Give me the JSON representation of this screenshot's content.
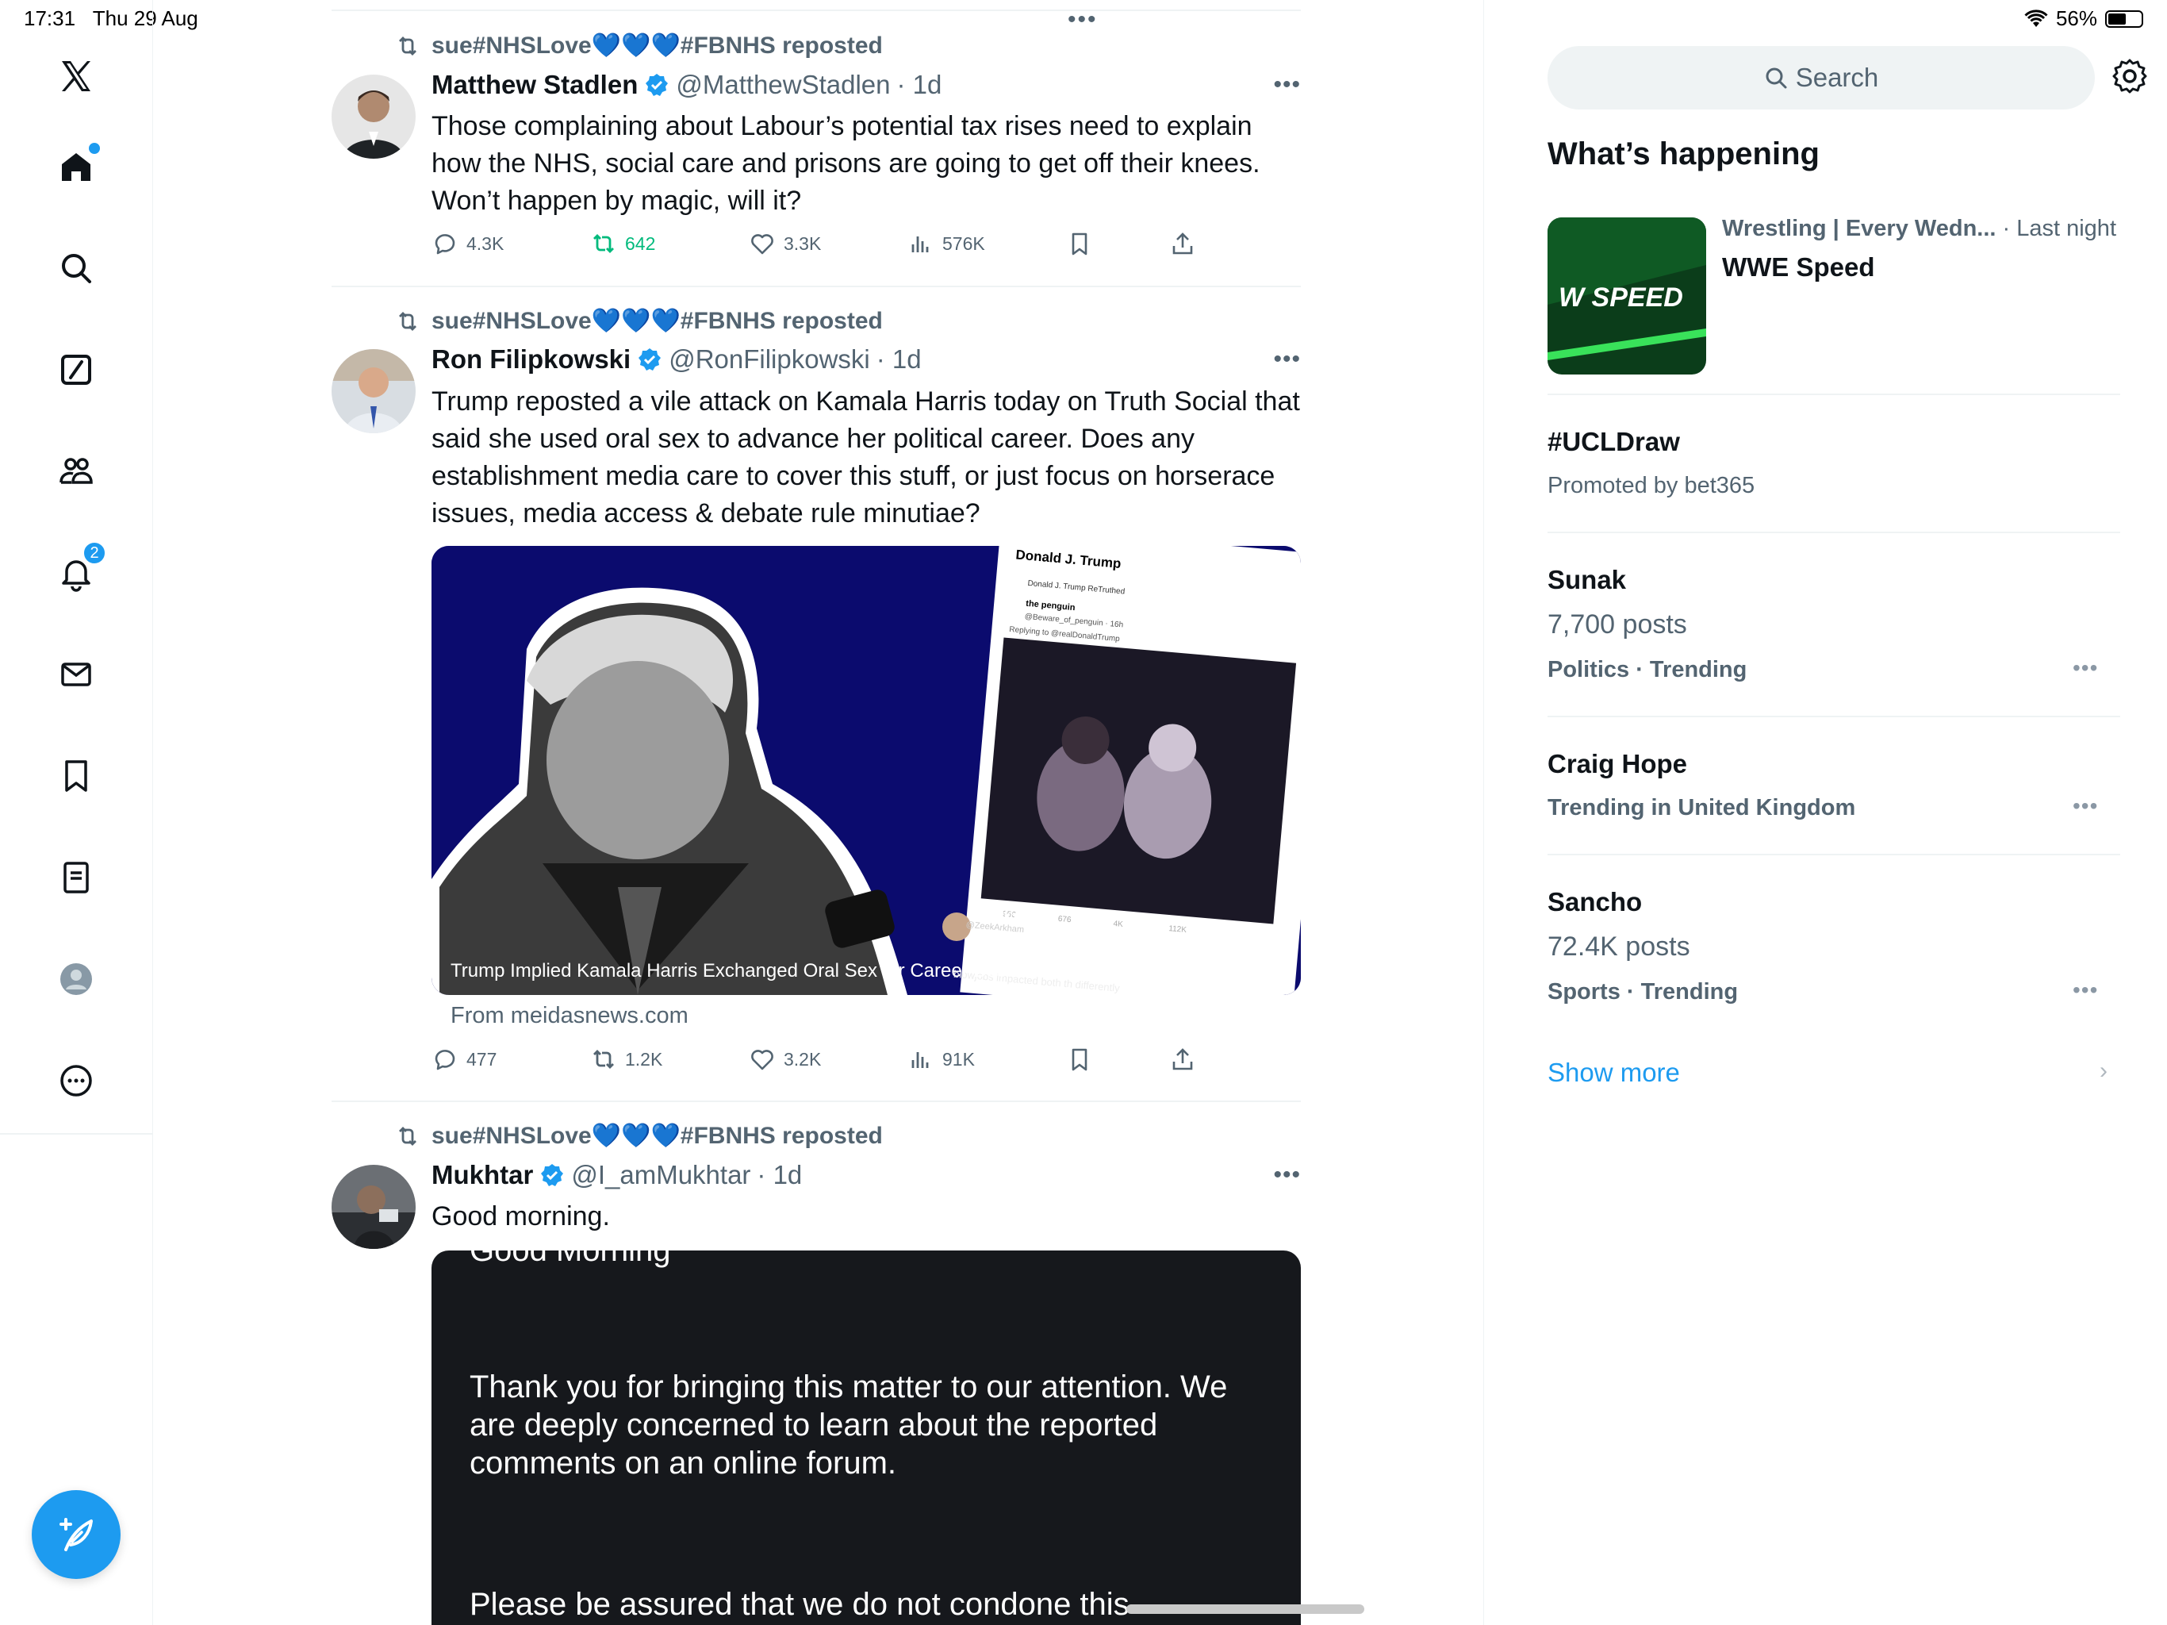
{
  "status_bar": {
    "time": "17:31",
    "date": "Thu 29 Aug",
    "battery": "56%",
    "battery_level": 0.56
  },
  "nav": {
    "icons": [
      "x-logo-icon",
      "home-icon",
      "search-icon",
      "grok-icon",
      "communities-icon",
      "notifications-icon",
      "messages-icon",
      "bookmarks-icon",
      "lists-icon",
      "profile-icon",
      "more-icon"
    ],
    "notification_count": "2"
  },
  "colors": {
    "accent": "#1d9bf0",
    "repost_green": "#00ba7c",
    "text_primary": "#0f1419",
    "text_secondary": "#536471"
  },
  "timeline": {
    "tweets": [
      {
        "reposted_by": "sue#NHSLove💙💙💙#FBNHS reposted",
        "name": "Matthew Stadlen",
        "handle": "@MatthewStadlen",
        "time": "· 1d",
        "text": "Those complaining about Labour’s potential tax rises need to explain how the NHS, social care and prisons are going to get off their knees. Won’t happen by magic, will it?",
        "replies": "4.3K",
        "reposts": "642",
        "likes": "3.3K",
        "views": "576K"
      },
      {
        "reposted_by": "sue#NHSLove💙💙💙#FBNHS reposted",
        "name": "Ron Filipkowski",
        "handle": "@RonFilipkowski",
        "time": "· 1d",
        "text": "Trump reposted a vile attack on Kamala Harris today on Truth Social that said she used oral sex to advance her political career. Does any establishment media care to cover this stuff, or just focus on horserace issues, media access & debate rule minutiae?",
        "card_caption": "Trump Implied Kamala Harris Exchanged Oral Sex for Career Boosts",
        "card_source": "From meidasnews.com",
        "card_screenshot": {
          "title": "Donald J. Trump",
          "retruthed": "Donald J. Trump ReTruthed",
          "user": "the penguin",
          "user_handle": "@Beware_of_penguin · 16h",
          "replying": "Replying to @realDonaldTrump",
          "stats": [
            "956",
            "676",
            "4K",
            "112K"
          ],
          "footer_user": "Zeek Arkham",
          "footer_handle": "@ZeekArkham",
          "footer_text": "blowjobs impacted both th differently"
        },
        "replies": "477",
        "reposts": "1.2K",
        "likes": "3.2K",
        "views": "91K"
      },
      {
        "reposted_by": "sue#NHSLove💙💙💙#FBNHS reposted",
        "name": "Mukhtar",
        "handle": "@I_amMukhtar",
        "time": "· 1d",
        "text": "Good morning.",
        "image_heading": "Good Morning",
        "image_para1": "Thank you for bringing this matter to our attention. We are deeply concerned to learn about the reported comments on an online forum.",
        "image_para2": "Please be assured that we do not condone this"
      }
    ]
  },
  "sidebar_right": {
    "search_placeholder": "Search",
    "heading": "What’s happening",
    "wwe": {
      "category": "Wrestling | Every Wedn...",
      "when": " · Last night",
      "title": "WWE Speed",
      "logo_text": "W SPEED"
    },
    "trends": [
      {
        "title": "#UCLDraw",
        "sub": "Promoted by bet365"
      },
      {
        "title": "Sunak",
        "sub": "7,700 posts",
        "meta": "Politics · Trending"
      },
      {
        "title": "Craig Hope",
        "meta": "Trending in United Kingdom"
      },
      {
        "title": "Sancho",
        "sub": "72.4K posts",
        "meta": "Sports · Trending"
      }
    ],
    "show_more": "Show more"
  }
}
